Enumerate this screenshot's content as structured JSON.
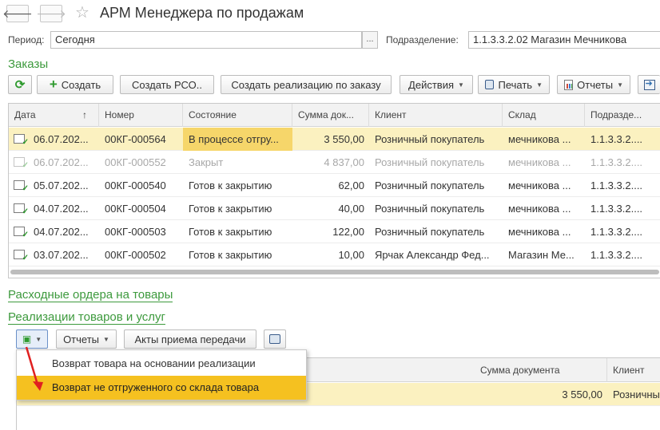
{
  "window": {
    "title": "АРМ Менеджера по продажам"
  },
  "filters": {
    "period_label": "Период:",
    "period_value": "Сегодня",
    "period_btn": "...",
    "division_label": "Подразделение:",
    "division_value": "1.1.3.3.2.02 Магазин Мечникова"
  },
  "orders": {
    "title": "Заказы",
    "toolbar": {
      "create": "Создать",
      "create_rso": "Создать РСО..",
      "create_sale": "Создать реализацию по заказу",
      "actions": "Действия",
      "print": "Печать",
      "reports": "Отчеты"
    },
    "columns": [
      "Дата",
      "Номер",
      "Состояние",
      "Сумма док...",
      "Клиент",
      "Склад",
      "Подразде..."
    ],
    "sort_indicator": "↑",
    "rows": [
      {
        "date": "06.07.202...",
        "number": "00КГ-000564",
        "status": "В процессе отгру...",
        "sum": "3 550,00",
        "client": "Розничный покупатель",
        "warehouse": "мечникова ...",
        "division": "1.1.3.3.2...."
      },
      {
        "date": "06.07.202...",
        "number": "00КГ-000552",
        "status": "Закрыт",
        "sum": "4 837,00",
        "client": "Розничный покупатель",
        "warehouse": "мечникова ...",
        "division": "1.1.3.3.2...."
      },
      {
        "date": "05.07.202...",
        "number": "00КГ-000540",
        "status": "Готов к закрытию",
        "sum": "62,00",
        "client": "Розничный покупатель",
        "warehouse": "мечникова ...",
        "division": "1.1.3.3.2...."
      },
      {
        "date": "04.07.202...",
        "number": "00КГ-000504",
        "status": "Готов к закрытию",
        "sum": "40,00",
        "client": "Розничный покупатель",
        "warehouse": "мечникова ...",
        "division": "1.1.3.3.2...."
      },
      {
        "date": "04.07.202...",
        "number": "00КГ-000503",
        "status": "Готов к закрытию",
        "sum": "122,00",
        "client": "Розничный покупатель",
        "warehouse": "мечникова ...",
        "division": "1.1.3.3.2...."
      },
      {
        "date": "03.07.202...",
        "number": "00КГ-000502",
        "status": "Готов к закрытию",
        "sum": "10,00",
        "client": "Ярчак Александр Фед...",
        "warehouse": "Магазин Ме...",
        "division": "1.1.3.3.2...."
      }
    ]
  },
  "links": {
    "expense_orders": "Расходные ордера на товары",
    "sales": "Реализации товаров и услуг"
  },
  "sales": {
    "toolbar": {
      "reports": "Отчеты",
      "acts": "Акты приема передачи"
    },
    "columns": [
      "Сумма документа",
      "Клиент"
    ],
    "row": {
      "sum": "3 550,00",
      "client": "Розничны"
    }
  },
  "dropdown": {
    "items": [
      "Возврат товара на основании реализации",
      "Возврат не отгруженного со склада товара"
    ]
  },
  "colors": {
    "accent_green": "#3d9a3d",
    "selection": "#fbf1c0",
    "menu_active": "#f5c120",
    "arrow": "#e02020"
  }
}
